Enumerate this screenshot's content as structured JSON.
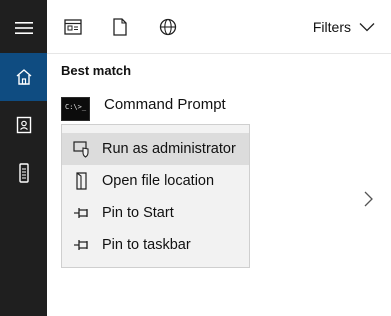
{
  "filters": {
    "label": "Filters"
  },
  "results": {
    "section_title": "Best match",
    "best_match": {
      "label": "Command Prompt",
      "thumb_text": "C:\\>_"
    }
  },
  "context_menu": {
    "items": [
      {
        "label": "Run as administrator",
        "icon": "shield-icon"
      },
      {
        "label": "Open file location",
        "icon": "folder-icon"
      },
      {
        "label": "Pin to Start",
        "icon": "pin-icon"
      },
      {
        "label": "Pin to taskbar",
        "icon": "pin-icon"
      }
    ]
  },
  "colors": {
    "rail": "#1f1f1f",
    "rail_active": "#0f4c81",
    "menu_bg": "#f2f2f2",
    "menu_hover": "#dcdcdc"
  }
}
